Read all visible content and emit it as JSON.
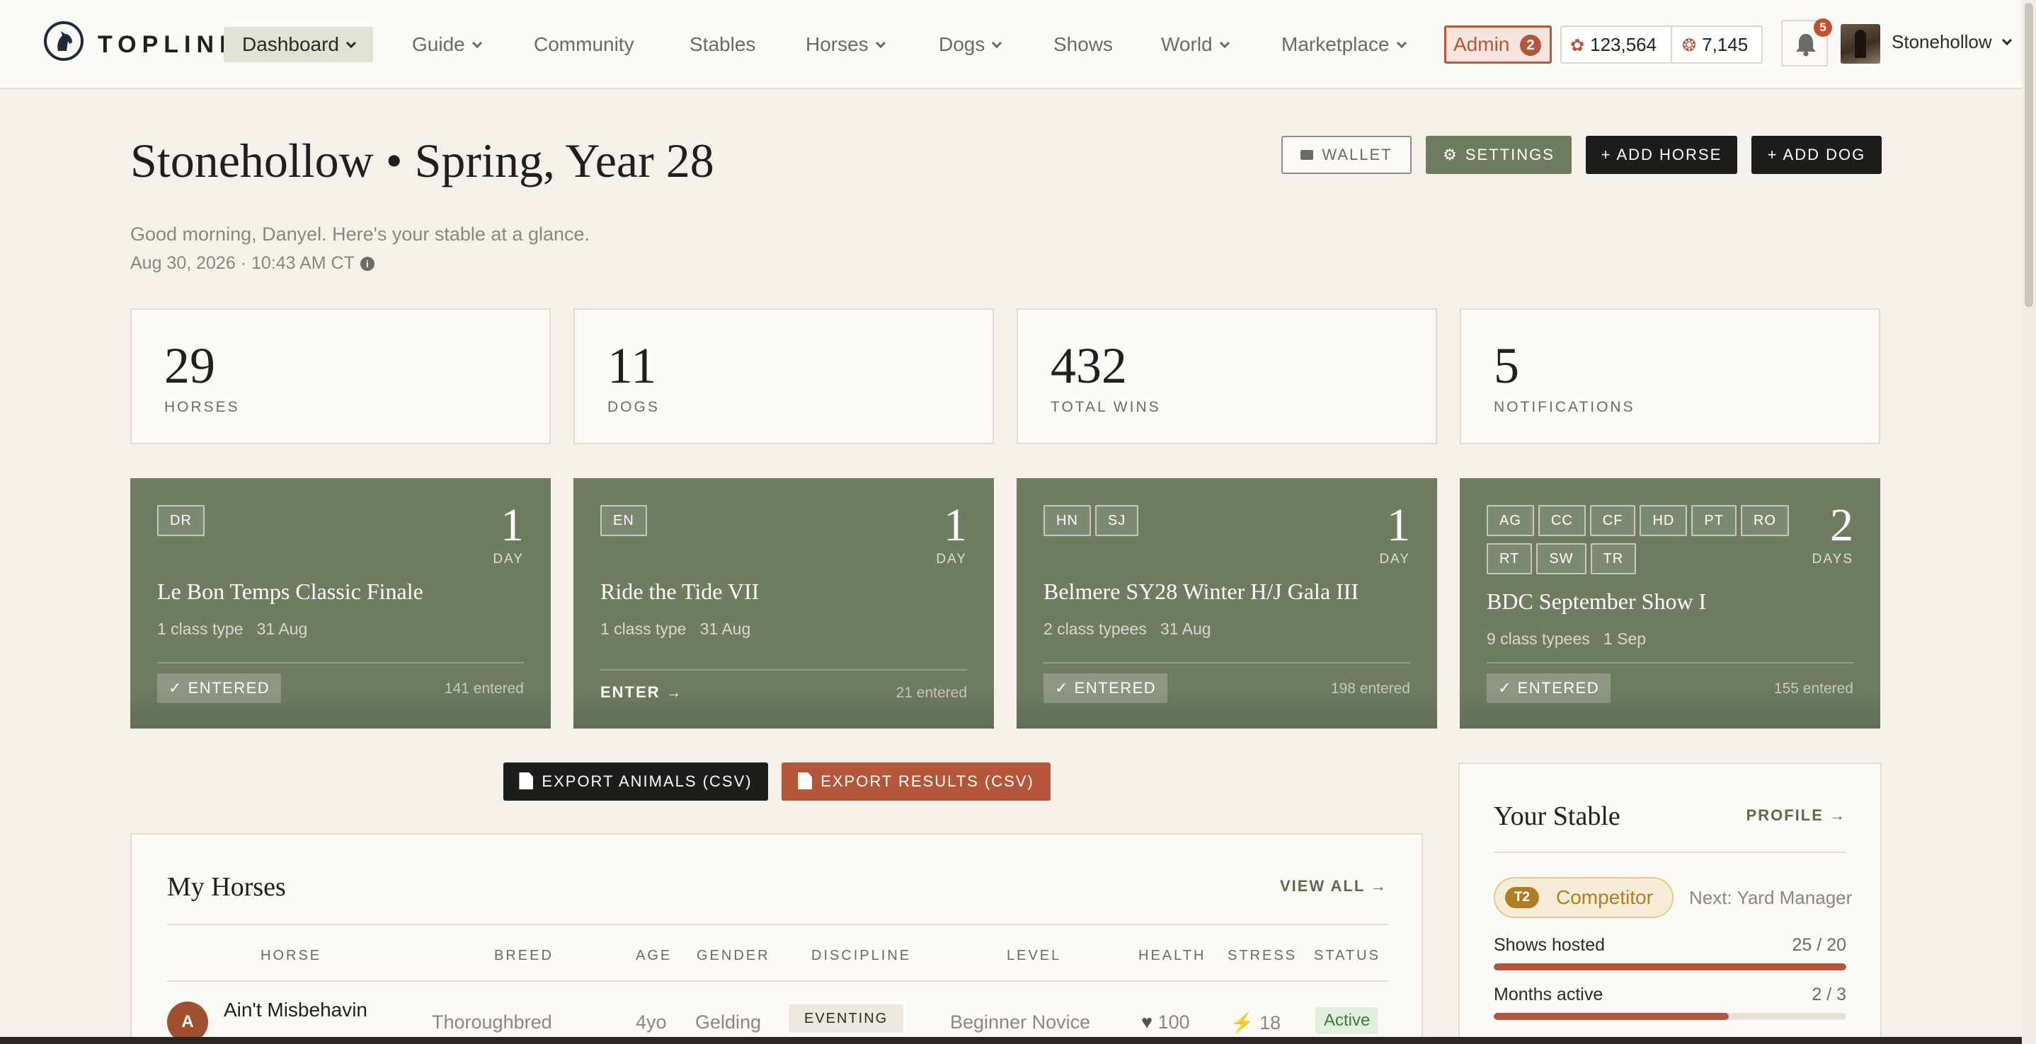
{
  "nav": {
    "brand": "TOPLINE",
    "items": [
      {
        "label": "Dashboard",
        "dropdown": true
      },
      {
        "label": "Guide",
        "dropdown": true
      },
      {
        "label": "Community",
        "dropdown": false
      },
      {
        "label": "Stables",
        "dropdown": false
      },
      {
        "label": "Horses",
        "dropdown": true
      },
      {
        "label": "Dogs",
        "dropdown": true
      },
      {
        "label": "Shows",
        "dropdown": false
      },
      {
        "label": "World",
        "dropdown": true
      },
      {
        "label": "Marketplace",
        "dropdown": true
      }
    ],
    "admin_label": "Admin",
    "admin_count": "2",
    "currency_primary": "123,564",
    "currency_secondary": "7,145",
    "notif_count": "5",
    "username": "Stonehollow"
  },
  "header": {
    "title": "Stonehollow • Spring, Year 28",
    "greeting": "Good morning, Danyel. Here's your stable at a glance.",
    "datetime": "Aug 30, 2026 · 10:43 AM CT",
    "buttons": {
      "wallet": "WALLET",
      "settings": "SETTINGS",
      "add_horse": "+ ADD HORSE",
      "add_dog": "+ ADD DOG"
    }
  },
  "stats": [
    {
      "value": "29",
      "label": "HORSES"
    },
    {
      "value": "11",
      "label": "DOGS"
    },
    {
      "value": "432",
      "label": "TOTAL WINS"
    },
    {
      "value": "5",
      "label": "NOTIFICATIONS"
    }
  ],
  "shows": [
    {
      "tags": [
        "DR"
      ],
      "days": "1",
      "days_label": "DAY",
      "title": "Le Bon Temps Classic Finale",
      "meta_classes": "1 class type",
      "meta_date": "31 Aug",
      "action": "ENTERED",
      "entered": true,
      "count": "141 entered"
    },
    {
      "tags": [
        "EN"
      ],
      "days": "1",
      "days_label": "DAY",
      "title": "Ride the Tide VII",
      "meta_classes": "1 class type",
      "meta_date": "31 Aug",
      "action": "ENTER →",
      "entered": false,
      "count": "21 entered"
    },
    {
      "tags": [
        "HN",
        "SJ"
      ],
      "days": "1",
      "days_label": "DAY",
      "title": "Belmere SY28 Winter H/J Gala III",
      "meta_classes": "2 class typees",
      "meta_date": "31 Aug",
      "action": "ENTERED",
      "entered": true,
      "count": "198 entered"
    },
    {
      "tags": [
        "AG",
        "CC",
        "CF",
        "HD",
        "PT",
        "RO",
        "RT",
        "SW",
        "TR"
      ],
      "days": "2",
      "days_label": "DAYS",
      "title": "BDC September Show I",
      "meta_classes": "9 class typees",
      "meta_date": "1 Sep",
      "action": "ENTERED",
      "entered": true,
      "count": "155 entered"
    }
  ],
  "exports": {
    "animals": "EXPORT ANIMALS (CSV)",
    "results": "EXPORT RESULTS (CSV)"
  },
  "horses_panel": {
    "title": "My Horses",
    "view_all": "VIEW ALL →",
    "columns": [
      "HORSE",
      "BREED",
      "AGE",
      "GENDER",
      "DISCIPLINE",
      "LEVEL",
      "HEALTH",
      "STRESS",
      "STATUS"
    ],
    "rows": [
      {
        "initial": "A",
        "name": "Ain't Misbehavin",
        "breed": "Thoroughbred",
        "age": "4yo",
        "gender": "Gelding",
        "discipline": "EVENTING",
        "level": "Beginner Novice",
        "health": "100",
        "stress": "18",
        "status": "Active"
      }
    ]
  },
  "stable_panel": {
    "title": "Your Stable",
    "profile": "PROFILE →",
    "tier_code": "T2",
    "tier_name": "Competitor",
    "next_tier": "Next: Yard Manager",
    "progress": [
      {
        "label": "Shows hosted",
        "value_text": "25 / 20",
        "fraction": 1.0
      },
      {
        "label": "Months active",
        "value_text": "2 / 3",
        "fraction": 0.667
      }
    ]
  },
  "colors": {
    "accent_green": "#6f7c60",
    "accent_rust": "#b5553a",
    "dark": "#1c1e1c",
    "background": "#f4f1ea"
  }
}
